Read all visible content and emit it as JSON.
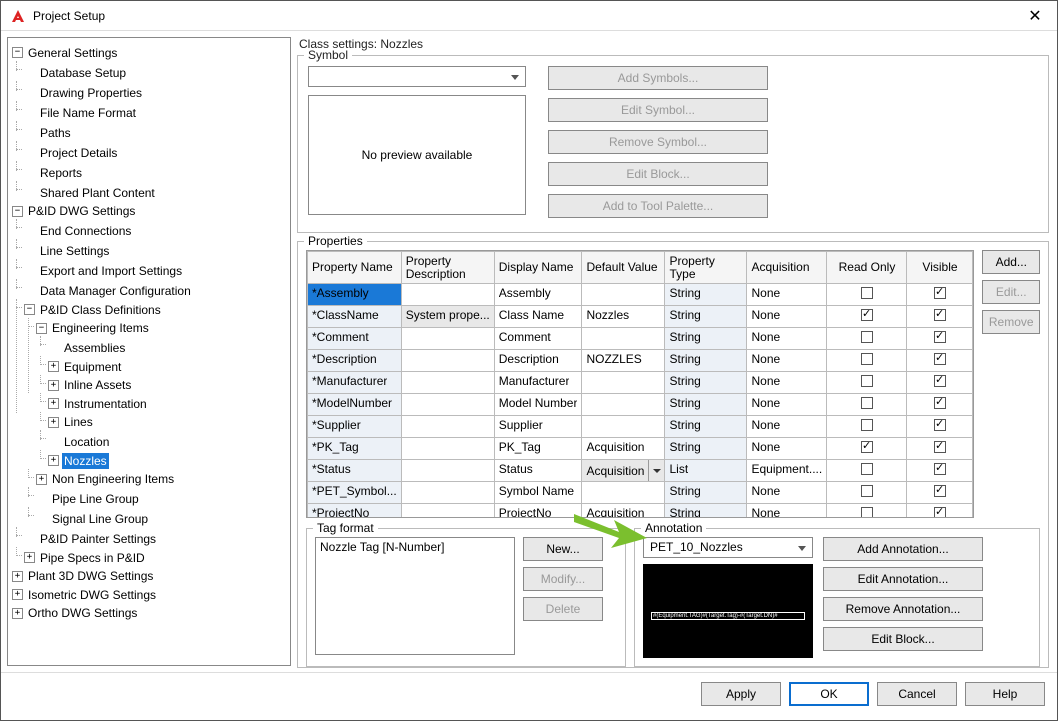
{
  "window": {
    "title": "Project Setup"
  },
  "tree": {
    "general": {
      "label": "General Settings",
      "children": [
        "Database Setup",
        "Drawing Properties",
        "File Name Format",
        "Paths",
        "Project Details",
        "Reports",
        "Shared Plant Content"
      ]
    },
    "pid": {
      "label": "P&ID DWG Settings",
      "end_conn": "End Connections",
      "line": "Line Settings",
      "exp": "Export and Import Settings",
      "dmc": "Data Manager Configuration",
      "classdef": {
        "label": "P&ID Class Definitions",
        "eng": {
          "label": "Engineering Items",
          "children": [
            "Assemblies",
            "Equipment",
            "Inline Assets",
            "Instrumentation",
            "Lines",
            "Location",
            "Nozzles"
          ]
        },
        "noneng": "Non Engineering Items",
        "plg": "Pipe Line Group",
        "slg": "Signal Line Group"
      },
      "painter": "P&ID Painter Settings",
      "specs": "Pipe Specs in P&ID"
    },
    "plant3d": "Plant 3D DWG Settings",
    "iso": "Isometric DWG Settings",
    "ortho": "Ortho DWG Settings"
  },
  "main": {
    "heading": "Class settings: Nozzles",
    "symbol": {
      "caption": "Symbol",
      "preview": "No preview available",
      "buttons": {
        "add": "Add Symbols...",
        "edit": "Edit Symbol...",
        "remove": "Remove Symbol...",
        "editblock": "Edit Block...",
        "palette": "Add to Tool Palette..."
      }
    },
    "props": {
      "caption": "Properties",
      "header": {
        "name": "Property Name",
        "desc": "Property Description",
        "disp": "Display Name",
        "def": "Default Value",
        "type": "Property Type",
        "acq": "Acquisition",
        "ro": "Read Only",
        "vis": "Visible"
      },
      "sidebtns": {
        "add": "Add...",
        "edit": "Edit...",
        "remove": "Remove"
      },
      "rows": [
        {
          "name": "*Assembly",
          "desc": "",
          "disp": "Assembly",
          "def": "",
          "type": "String",
          "acq": "None",
          "ro": false,
          "vis": true,
          "sel": true
        },
        {
          "name": "*ClassName",
          "desc": "System prope...",
          "disp": "Class Name",
          "def": "Nozzles",
          "type": "String",
          "acq": "None",
          "ro": true,
          "vis": true
        },
        {
          "name": "*Comment",
          "desc": "",
          "disp": "Comment",
          "def": "",
          "type": "String",
          "acq": "None",
          "ro": false,
          "vis": true
        },
        {
          "name": "*Description",
          "desc": "",
          "disp": "Description",
          "def": "NOZZLES",
          "type": "String",
          "acq": "None",
          "ro": false,
          "vis": true
        },
        {
          "name": "*Manufacturer",
          "desc": "",
          "disp": "Manufacturer",
          "def": "",
          "type": "String",
          "acq": "None",
          "ro": false,
          "vis": true
        },
        {
          "name": "*ModelNumber",
          "desc": "",
          "disp": "Model Number",
          "def": "",
          "type": "String",
          "acq": "None",
          "ro": false,
          "vis": true
        },
        {
          "name": "*Supplier",
          "desc": "",
          "disp": "Supplier",
          "def": "",
          "type": "String",
          "acq": "None",
          "ro": false,
          "vis": true
        },
        {
          "name": "*PK_Tag",
          "desc": "",
          "disp": "PK_Tag",
          "def": "Acquisition",
          "type": "String",
          "acq": "None",
          "ro": true,
          "vis": true
        },
        {
          "name": "*Status",
          "desc": "",
          "disp": "Status",
          "def": "Acquisition",
          "defdd": true,
          "type": "List",
          "acq": "Equipment....",
          "ro": false,
          "vis": true
        },
        {
          "name": "*PET_Symbol...",
          "desc": "",
          "disp": "Symbol Name",
          "def": "",
          "type": "String",
          "acq": "None",
          "ro": false,
          "vis": true
        },
        {
          "name": "*ProjectNo",
          "desc": "",
          "disp": "ProjectNo",
          "def": "Acquisition",
          "type": "String",
          "acq": "None",
          "ro": false,
          "vis": true
        }
      ]
    },
    "tag": {
      "caption": "Tag format",
      "item": "Nozzle Tag [N-Number]",
      "buttons": {
        "new": "New...",
        "modify": "Modify...",
        "delete": "Delete"
      }
    },
    "annot": {
      "caption": "Annotation",
      "selected": "PET_10_Nozzles",
      "previewText": "#(Equipment.TAG)#(Target.Tag)-#(Target.DN)#(Target.Spec)",
      "buttons": {
        "add": "Add Annotation...",
        "edit": "Edit Annotation...",
        "remove": "Remove Annotation...",
        "editblock": "Edit Block..."
      }
    }
  },
  "footer": {
    "apply": "Apply",
    "ok": "OK",
    "cancel": "Cancel",
    "help": "Help"
  }
}
